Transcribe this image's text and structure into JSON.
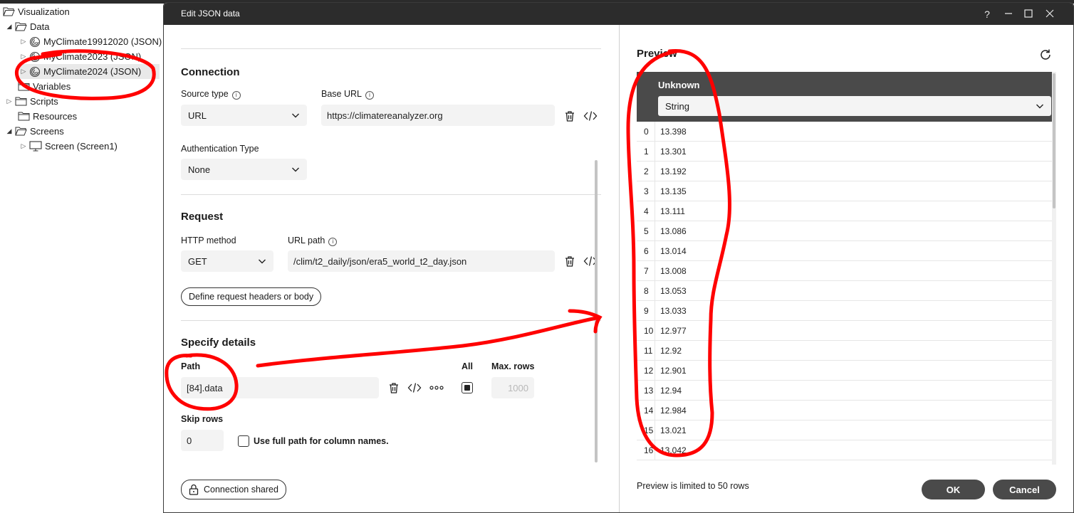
{
  "tree": {
    "items": [
      {
        "label": "Visualization"
      },
      {
        "label": "Data"
      },
      {
        "label": "MyClimate19912020 (JSON)"
      },
      {
        "label": "MyClimate2023 (JSON)"
      },
      {
        "label": "MyClimate2024 (JSON)"
      },
      {
        "label": "Variables"
      },
      {
        "label": "Scripts"
      },
      {
        "label": "Resources"
      },
      {
        "label": "Screens"
      },
      {
        "label": "Screen (Screen1)"
      }
    ]
  },
  "dialog": {
    "title": "Edit JSON data",
    "help": "?",
    "connection": {
      "heading": "Connection",
      "source_type_label": "Source type",
      "source_type_value": "URL",
      "base_url_label": "Base URL",
      "base_url_value": "https://climatereanalyzer.org",
      "auth_label": "Authentication Type",
      "auth_value": "None"
    },
    "request": {
      "heading": "Request",
      "method_label": "HTTP method",
      "method_value": "GET",
      "url_path_label": "URL path",
      "url_path_value": "/clim/t2_daily/json/era5_world_t2_day.json",
      "headers_button": "Define request headers or body"
    },
    "details": {
      "heading": "Specify details",
      "path_label": "Path",
      "path_value": "[84].data",
      "all_label": "All",
      "all_checked": true,
      "max_rows_label": "Max. rows",
      "max_rows_value": "1000",
      "skip_rows_label": "Skip rows",
      "skip_rows_value": "0",
      "full_path_label": "Use full path for column names.",
      "full_path_checked": false
    },
    "connection_shared": "Connection shared",
    "preview": {
      "title": "Preview",
      "column_name": "Unknown",
      "column_type": "String",
      "rows": [
        {
          "index": "0",
          "value": "13.398"
        },
        {
          "index": "1",
          "value": "13.301"
        },
        {
          "index": "2",
          "value": "13.192"
        },
        {
          "index": "3",
          "value": "13.135"
        },
        {
          "index": "4",
          "value": "13.111"
        },
        {
          "index": "5",
          "value": "13.086"
        },
        {
          "index": "6",
          "value": "13.014"
        },
        {
          "index": "7",
          "value": "13.008"
        },
        {
          "index": "8",
          "value": "13.053"
        },
        {
          "index": "9",
          "value": "13.033"
        },
        {
          "index": "10",
          "value": "12.977"
        },
        {
          "index": "11",
          "value": "12.92"
        },
        {
          "index": "12",
          "value": "12.901"
        },
        {
          "index": "13",
          "value": "12.94"
        },
        {
          "index": "14",
          "value": "12.984"
        },
        {
          "index": "15",
          "value": "13.021"
        },
        {
          "index": "16",
          "value": "13.042"
        }
      ],
      "note": "Preview is limited to 50 rows"
    },
    "ok_label": "OK",
    "cancel_label": "Cancel"
  },
  "colors": {
    "titlebar": "#2c2c2c",
    "annotation": "#ff0000",
    "dark_button": "#4a4a4a"
  }
}
